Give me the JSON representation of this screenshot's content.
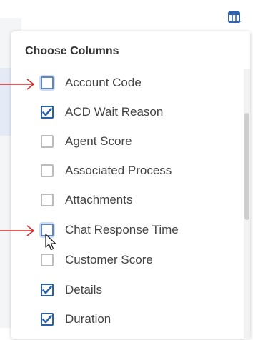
{
  "column_chooser": {
    "title": "Choose Columns",
    "options": [
      {
        "label": "Account Code",
        "checked": false
      },
      {
        "label": "ACD Wait Reason",
        "checked": true
      },
      {
        "label": "Agent Score",
        "checked": false
      },
      {
        "label": "Associated Process",
        "checked": false
      },
      {
        "label": "Attachments",
        "checked": false
      },
      {
        "label": "Chat Response Time",
        "checked": false
      },
      {
        "label": "Customer Score",
        "checked": false
      },
      {
        "label": "Details",
        "checked": true
      },
      {
        "label": "Duration",
        "checked": true
      }
    ]
  },
  "colors": {
    "checkbox_accent": "#2a60a8",
    "annotation_arrow": "#d62b2b",
    "toolbar_icon": "#2f63b0"
  },
  "icons": {
    "toolbar": "columns-settings-icon",
    "checkmark": "checkmark-icon",
    "annotation": "arrow-right-icon",
    "pointer": "mouse-pointer-icon"
  }
}
